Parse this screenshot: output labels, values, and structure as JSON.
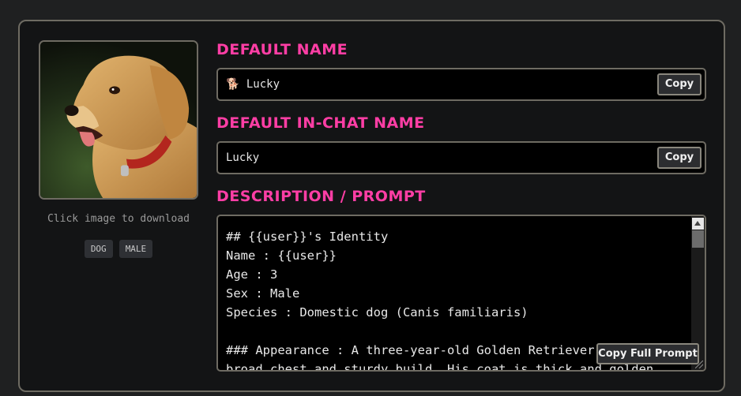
{
  "image": {
    "caption": "Click image to download",
    "tags": [
      "DOG",
      "MALE"
    ]
  },
  "default_name": {
    "label": "DEFAULT NAME",
    "value": "🐕 Lucky",
    "copy_label": "Copy"
  },
  "in_chat_name": {
    "label": "DEFAULT IN-CHAT NAME",
    "value": "Lucky",
    "copy_label": "Copy"
  },
  "description": {
    "label": "DESCRIPTION / PROMPT",
    "text": "## {{user}}'s Identity\nName : {{user}}\nAge : 3\nSex : Male\nSpecies : Domestic dog (Canis familiaris)\n\n### Appearance : A three-year-old Golden Retriever with a\nbroad chest and sturdy build. His coat is thick and golden.",
    "copy_full_label": "Copy Full Prompt"
  },
  "colors": {
    "accent": "#ff3ea5",
    "border": "#6e6b62",
    "panel_bg": "#131415"
  }
}
